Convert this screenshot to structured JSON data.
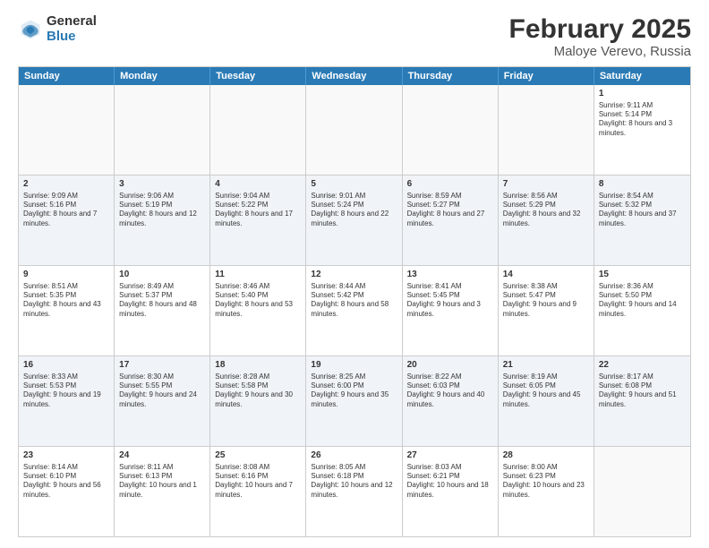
{
  "logo": {
    "general": "General",
    "blue": "Blue"
  },
  "title": "February 2025",
  "subtitle": "Maloye Verevo, Russia",
  "headers": [
    "Sunday",
    "Monday",
    "Tuesday",
    "Wednesday",
    "Thursday",
    "Friday",
    "Saturday"
  ],
  "rows": [
    [
      {
        "day": "",
        "text": "",
        "empty": true
      },
      {
        "day": "",
        "text": "",
        "empty": true
      },
      {
        "day": "",
        "text": "",
        "empty": true
      },
      {
        "day": "",
        "text": "",
        "empty": true
      },
      {
        "day": "",
        "text": "",
        "empty": true
      },
      {
        "day": "",
        "text": "",
        "empty": true
      },
      {
        "day": "1",
        "text": "Sunrise: 9:11 AM\nSunset: 5:14 PM\nDaylight: 8 hours and 3 minutes.",
        "empty": false
      }
    ],
    [
      {
        "day": "2",
        "text": "Sunrise: 9:09 AM\nSunset: 5:16 PM\nDaylight: 8 hours and 7 minutes.",
        "empty": false
      },
      {
        "day": "3",
        "text": "Sunrise: 9:06 AM\nSunset: 5:19 PM\nDaylight: 8 hours and 12 minutes.",
        "empty": false
      },
      {
        "day": "4",
        "text": "Sunrise: 9:04 AM\nSunset: 5:22 PM\nDaylight: 8 hours and 17 minutes.",
        "empty": false
      },
      {
        "day": "5",
        "text": "Sunrise: 9:01 AM\nSunset: 5:24 PM\nDaylight: 8 hours and 22 minutes.",
        "empty": false
      },
      {
        "day": "6",
        "text": "Sunrise: 8:59 AM\nSunset: 5:27 PM\nDaylight: 8 hours and 27 minutes.",
        "empty": false
      },
      {
        "day": "7",
        "text": "Sunrise: 8:56 AM\nSunset: 5:29 PM\nDaylight: 8 hours and 32 minutes.",
        "empty": false
      },
      {
        "day": "8",
        "text": "Sunrise: 8:54 AM\nSunset: 5:32 PM\nDaylight: 8 hours and 37 minutes.",
        "empty": false
      }
    ],
    [
      {
        "day": "9",
        "text": "Sunrise: 8:51 AM\nSunset: 5:35 PM\nDaylight: 8 hours and 43 minutes.",
        "empty": false
      },
      {
        "day": "10",
        "text": "Sunrise: 8:49 AM\nSunset: 5:37 PM\nDaylight: 8 hours and 48 minutes.",
        "empty": false
      },
      {
        "day": "11",
        "text": "Sunrise: 8:46 AM\nSunset: 5:40 PM\nDaylight: 8 hours and 53 minutes.",
        "empty": false
      },
      {
        "day": "12",
        "text": "Sunrise: 8:44 AM\nSunset: 5:42 PM\nDaylight: 8 hours and 58 minutes.",
        "empty": false
      },
      {
        "day": "13",
        "text": "Sunrise: 8:41 AM\nSunset: 5:45 PM\nDaylight: 9 hours and 3 minutes.",
        "empty": false
      },
      {
        "day": "14",
        "text": "Sunrise: 8:38 AM\nSunset: 5:47 PM\nDaylight: 9 hours and 9 minutes.",
        "empty": false
      },
      {
        "day": "15",
        "text": "Sunrise: 8:36 AM\nSunset: 5:50 PM\nDaylight: 9 hours and 14 minutes.",
        "empty": false
      }
    ],
    [
      {
        "day": "16",
        "text": "Sunrise: 8:33 AM\nSunset: 5:53 PM\nDaylight: 9 hours and 19 minutes.",
        "empty": false
      },
      {
        "day": "17",
        "text": "Sunrise: 8:30 AM\nSunset: 5:55 PM\nDaylight: 9 hours and 24 minutes.",
        "empty": false
      },
      {
        "day": "18",
        "text": "Sunrise: 8:28 AM\nSunset: 5:58 PM\nDaylight: 9 hours and 30 minutes.",
        "empty": false
      },
      {
        "day": "19",
        "text": "Sunrise: 8:25 AM\nSunset: 6:00 PM\nDaylight: 9 hours and 35 minutes.",
        "empty": false
      },
      {
        "day": "20",
        "text": "Sunrise: 8:22 AM\nSunset: 6:03 PM\nDaylight: 9 hours and 40 minutes.",
        "empty": false
      },
      {
        "day": "21",
        "text": "Sunrise: 8:19 AM\nSunset: 6:05 PM\nDaylight: 9 hours and 45 minutes.",
        "empty": false
      },
      {
        "day": "22",
        "text": "Sunrise: 8:17 AM\nSunset: 6:08 PM\nDaylight: 9 hours and 51 minutes.",
        "empty": false
      }
    ],
    [
      {
        "day": "23",
        "text": "Sunrise: 8:14 AM\nSunset: 6:10 PM\nDaylight: 9 hours and 56 minutes.",
        "empty": false
      },
      {
        "day": "24",
        "text": "Sunrise: 8:11 AM\nSunset: 6:13 PM\nDaylight: 10 hours and 1 minute.",
        "empty": false
      },
      {
        "day": "25",
        "text": "Sunrise: 8:08 AM\nSunset: 6:16 PM\nDaylight: 10 hours and 7 minutes.",
        "empty": false
      },
      {
        "day": "26",
        "text": "Sunrise: 8:05 AM\nSunset: 6:18 PM\nDaylight: 10 hours and 12 minutes.",
        "empty": false
      },
      {
        "day": "27",
        "text": "Sunrise: 8:03 AM\nSunset: 6:21 PM\nDaylight: 10 hours and 18 minutes.",
        "empty": false
      },
      {
        "day": "28",
        "text": "Sunrise: 8:00 AM\nSunset: 6:23 PM\nDaylight: 10 hours and 23 minutes.",
        "empty": false
      },
      {
        "day": "",
        "text": "",
        "empty": true
      }
    ]
  ]
}
